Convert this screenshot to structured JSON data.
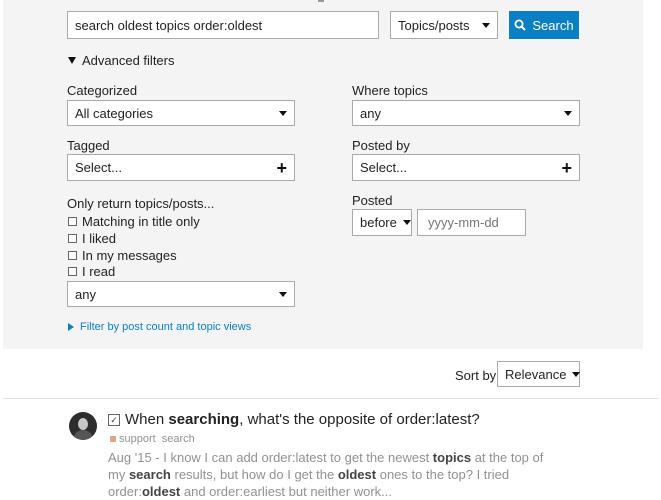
{
  "search": {
    "query": "search oldest topics order:oldest",
    "type_select": "Topics/posts",
    "button_label": "Search"
  },
  "advanced": {
    "toggle_label": "Advanced filters",
    "categorized_label": "Categorized",
    "categorized_value": "All categories",
    "tagged_label": "Tagged",
    "tagged_value": "Select...",
    "only_return_label": "Only return topics/posts...",
    "checks": [
      "Matching in title only",
      "I liked",
      "In my messages",
      "I read"
    ],
    "only_return_select": "any",
    "where_topics_label": "Where topics",
    "where_topics_value": "any",
    "posted_by_label": "Posted by",
    "posted_by_value": "Select...",
    "posted_label": "Posted",
    "posted_when": "before",
    "date_placeholder": "yyyy-mm-dd",
    "filter_link": "Filter by post count and topic views"
  },
  "sort": {
    "label": "Sort by",
    "value": "Relevance"
  },
  "result": {
    "title_pre": "When ",
    "title_bold": "searching",
    "title_post": ", what's the opposite of order:latest?",
    "category": "support",
    "tag": "search",
    "date": "Aug '15",
    "blurb_parts": [
      " - I know I can add order:latest to get the newest ",
      "topics",
      " at the top of my ",
      "search",
      " results, but how do I get the ",
      "oldest",
      " ones to the top? I tried order:",
      "oldest",
      " and order:earliest but neither work..."
    ]
  }
}
